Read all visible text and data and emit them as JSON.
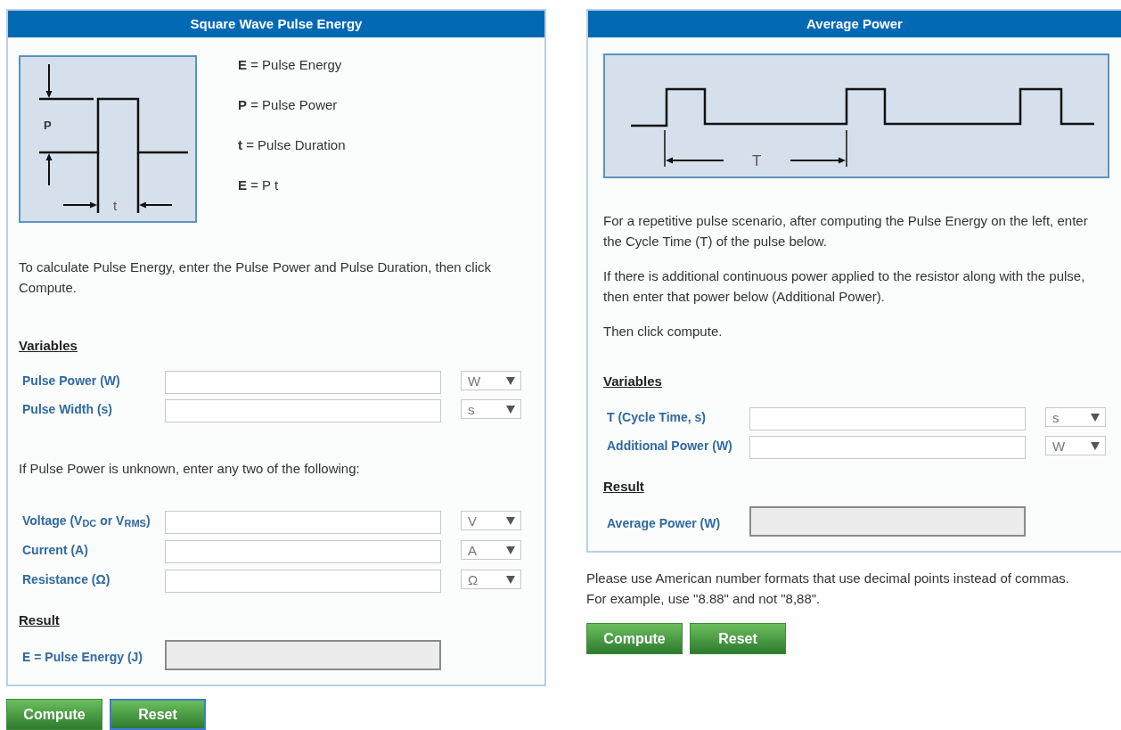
{
  "pulse_energy_panel": {
    "title": "Square Wave Pulse Energy",
    "diagram": {
      "height_label": "P",
      "width_label": "t"
    },
    "legend": [
      "**E** = Pulse Energy",
      "**P** = Pulse Power",
      "**t** = Pulse Duration",
      "**E** = P t"
    ],
    "instructions": "To calculate Pulse Energy, enter the Pulse Power and Pulse Duration, then click Compute.",
    "variables_heading": "Variables",
    "variables": [
      {
        "label": "Pulse Power (W)",
        "unit": "W"
      },
      {
        "label": "Pulse Width (s)",
        "unit": "s"
      }
    ],
    "alternative_note": "If Pulse Power is unknown, enter any two of the following:",
    "alternative_variables": [
      {
        "label": "Voltage (V$_{DC}$ or V$_{RMS}$)",
        "unit": "V"
      },
      {
        "label": "Current (A)",
        "unit": "A"
      },
      {
        "label": "Resistance (Ω)",
        "unit": "Ω"
      }
    ],
    "result_heading": "Result",
    "result": {
      "label": "E = Pulse Energy (J)"
    }
  },
  "pulse_energy_buttons": [
    {
      "label": "Compute",
      "focused": false
    },
    {
      "label": "Reset",
      "focused": true
    }
  ],
  "average_power_panel": {
    "title": "Average Power",
    "diagram": {
      "period_label": "T"
    },
    "paragraphs": [
      "For a repetitive pulse scenario, after computing the Pulse Energy on the left, enter the Cycle Time (T) of the pulse below.",
      "If there is additional continuous power applied to the resistor along with the pulse, then enter that power below (Additional Power).",
      "Then click compute."
    ],
    "variables_heading": "Variables",
    "variables": [
      {
        "label": "T (Cycle Time, s)",
        "unit": "s"
      },
      {
        "label": "Additional Power (W)",
        "unit": "W"
      }
    ],
    "result_heading": "Result",
    "result": {
      "label": "Average Power (W)"
    }
  },
  "number_format_note": [
    "Please use American number formats that use decimal points instead of commas.",
    "For example, use \"8.88\" and not \"8,88\"."
  ],
  "average_power_buttons": [
    {
      "label": "Compute",
      "focused": false
    },
    {
      "label": "Reset",
      "focused": false
    }
  ]
}
